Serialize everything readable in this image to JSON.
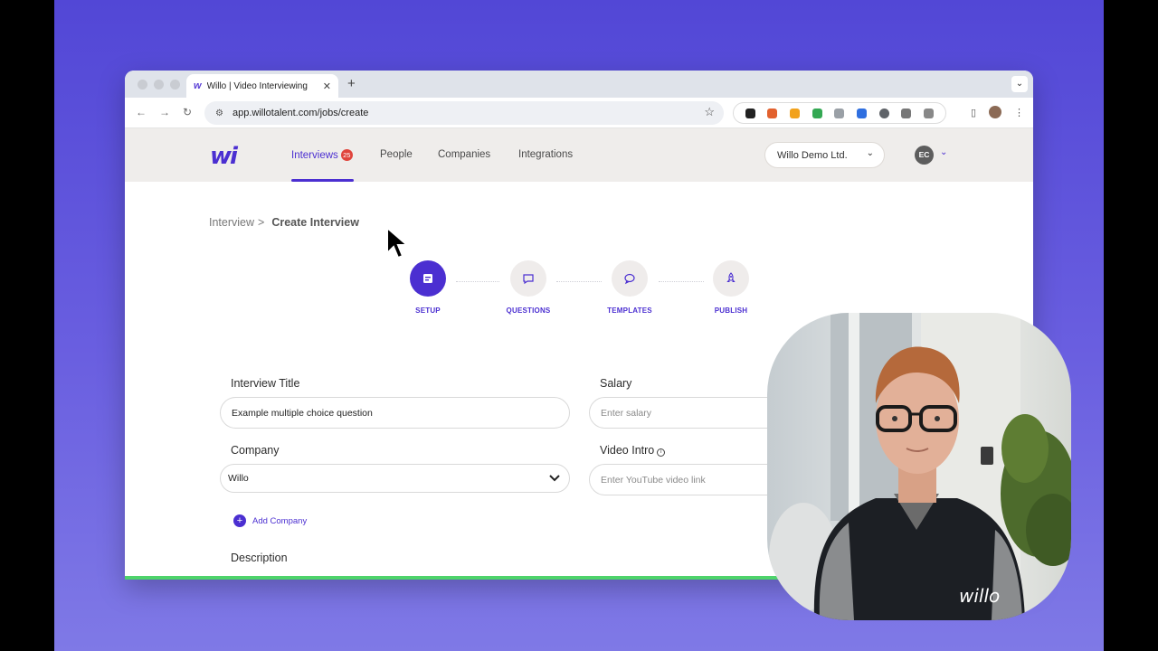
{
  "browser": {
    "tab_title": "Willo | Video Interviewing",
    "tab_favicon": "w",
    "tab_close": "✕",
    "new_tab": "+",
    "url": "app.willotalent.com/jobs/create"
  },
  "appnav": {
    "logo": "wi",
    "links": [
      {
        "label": "Interviews",
        "badge": "25"
      },
      {
        "label": "People"
      },
      {
        "label": "Companies"
      },
      {
        "label": "Integrations"
      }
    ],
    "company_select": "Willo Demo Ltd.",
    "user_initials": "EC"
  },
  "breadcrumb": {
    "parent": "Interview",
    "separator": ">",
    "current": "Create Interview"
  },
  "steps": [
    {
      "label": "SETUP",
      "icon": "setup-icon",
      "active": true
    },
    {
      "label": "QUESTIONS",
      "icon": "chat-square-icon",
      "active": false
    },
    {
      "label": "TEMPLATES",
      "icon": "chat-bubble-icon",
      "active": false
    },
    {
      "label": "PUBLISH",
      "icon": "rocket-icon",
      "active": false
    }
  ],
  "form": {
    "interview_title_label": "Interview Title",
    "interview_title_value": "Example multiple choice question",
    "salary_label": "Salary",
    "salary_placeholder": "Enter salary",
    "company_label": "Company",
    "company_value": "Willo",
    "video_intro_label": "Video Intro",
    "video_intro_placeholder": "Enter YouTube video link",
    "add_company": "Add Company",
    "description_label": "Description"
  },
  "colors": {
    "brand": "#4b2fd1",
    "badge": "#e0453c",
    "background": "#5247d6"
  }
}
